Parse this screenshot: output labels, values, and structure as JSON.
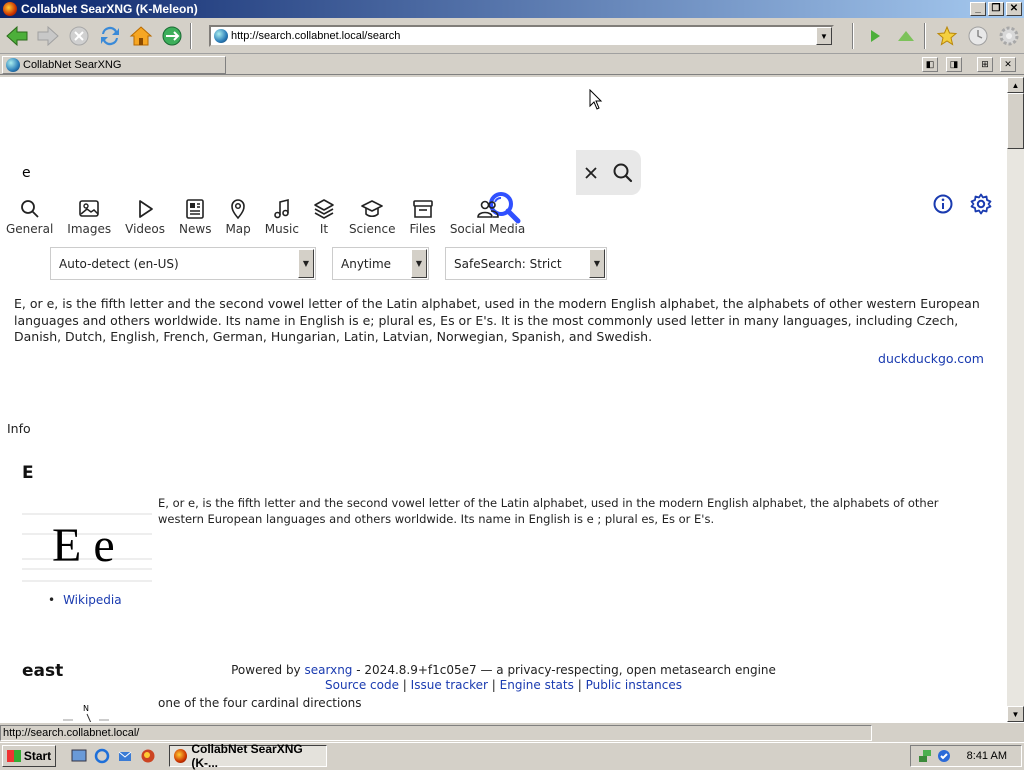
{
  "window": {
    "title": "CollabNet SearXNG (K-Meleon)"
  },
  "navbar": {
    "url": "http://search.collabnet.local/search"
  },
  "tab": {
    "label": "CollabNet SearXNG"
  },
  "search": {
    "query": "e"
  },
  "categories": [
    {
      "label": "General",
      "icon": "search-icon"
    },
    {
      "label": "Images",
      "icon": "image-icon"
    },
    {
      "label": "Videos",
      "icon": "play-icon"
    },
    {
      "label": "News",
      "icon": "newspaper-icon"
    },
    {
      "label": "Map",
      "icon": "map-pin-icon"
    },
    {
      "label": "Music",
      "icon": "music-note-icon"
    },
    {
      "label": "It",
      "icon": "layers-icon"
    },
    {
      "label": "Science",
      "icon": "graduation-cap-icon"
    },
    {
      "label": "Files",
      "icon": "archive-icon"
    },
    {
      "label": "Social Media",
      "icon": "people-icon"
    }
  ],
  "filters": {
    "language": "Auto-detect (en-US)",
    "time": "Anytime",
    "safesearch": "SafeSearch: Strict"
  },
  "answer": {
    "text": "E, or e, is the fifth letter and the second vowel letter of the Latin alphabet, used in the modern English alphabet, the alphabets of other western European languages and others worldwide. Its name in English is e; plural es, Es or E's. It is the most commonly used letter in many languages, including Czech, Danish, Dutch, English, French, German, Hungarian, Latin, Latvian, Norwegian, Spanish, and Swedish.",
    "source": "duckduckgo.com"
  },
  "infobox": {
    "heading": "Info",
    "title": "E",
    "image_text": "E e",
    "description": "E, or e, is the fifth letter and the second vowel letter of the Latin alphabet, used in the modern English alphabet, the alphabets of other western European languages and others worldwide. Its name in English is e ; plural es, Es or E's.",
    "link": "Wikipedia"
  },
  "result2": {
    "title": "east",
    "description": "one of the four cardinal directions",
    "compass_label": "N"
  },
  "footer": {
    "powered_prefix": "Powered by",
    "engine_name": "searxng",
    "version_text": "- 2024.8.9+f1c05e7 — a privacy-respecting, open metasearch engine",
    "links": [
      "Source code",
      "Issue tracker",
      "Engine stats",
      "Public instances"
    ],
    "separator": "|"
  },
  "status": {
    "text": "http://search.collabnet.local/"
  },
  "taskbar": {
    "start_label": "Start",
    "task_label": "CollabNet SearXNG (K-...",
    "clock": "8:41 AM"
  },
  "colors": {
    "accent": "#3050ff",
    "link": "#1a3bb0",
    "titlebar": "#0a246a"
  }
}
